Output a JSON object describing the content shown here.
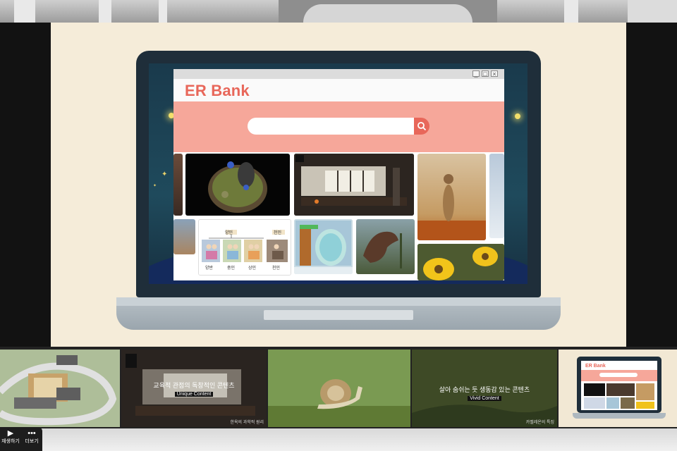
{
  "browser": {
    "brand": "ER Bank",
    "search": {
      "value": "",
      "placeholder": ""
    },
    "window_controls": [
      "_",
      "□",
      "×"
    ],
    "chart_labels": {
      "top": "양민",
      "right": "천민",
      "columns": [
        "양반",
        "중인",
        "상민",
        "천민"
      ]
    }
  },
  "filmstrip": [
    {
      "id": "scene-1",
      "title": "",
      "subtitle": "",
      "corner": ""
    },
    {
      "id": "scene-2",
      "title": "교육적 관점의 독창적인 콘텐츠",
      "subtitle": "Unique Content",
      "corner": "한옥의 과학적 원리"
    },
    {
      "id": "scene-3",
      "title": "",
      "subtitle": "",
      "corner": ""
    },
    {
      "id": "scene-4",
      "title": "살아 숨쉬는 듯 생동감 있는 콘텐츠",
      "subtitle": "Vivid Content",
      "corner": "카멜레온의 특징"
    },
    {
      "id": "scene-5",
      "title": "ER Bank",
      "subtitle": "",
      "corner": ""
    }
  ],
  "controls": {
    "play_label": "재생하기",
    "more_label": "더보기"
  },
  "colors": {
    "brand": "#e8675a",
    "search_band": "#f6a79a",
    "stage": "#f5ecd9"
  }
}
